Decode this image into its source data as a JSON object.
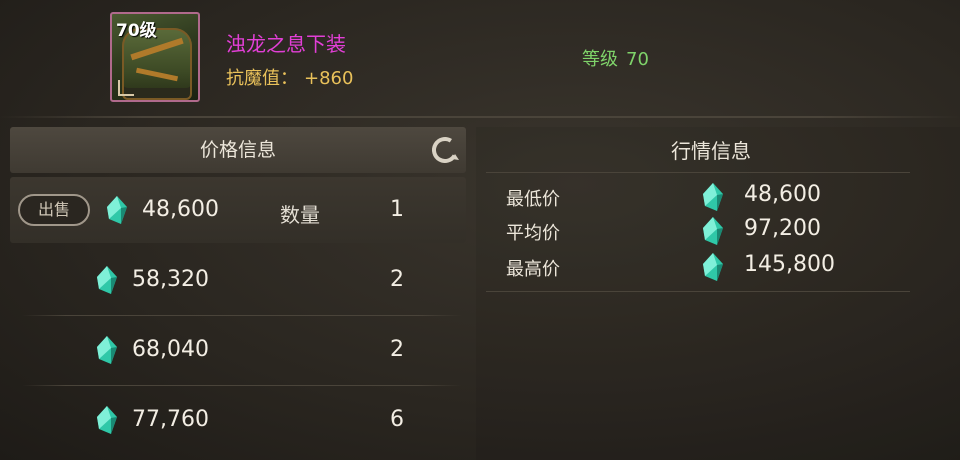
{
  "item": {
    "level_badge": "70级",
    "name": "浊龙之息下装",
    "stat_label": "抗魔值：",
    "stat_value": "+860",
    "req_level_label": "等级",
    "req_level_value": "70",
    "icon": "armor-leggings-icon",
    "name_color": "#e23fd6"
  },
  "price_panel": {
    "title": "价格信息",
    "refresh_icon": "refresh-icon",
    "sell_label": "出售",
    "qty_label": "数量",
    "rows": [
      {
        "price": "48,600",
        "qty": "1"
      },
      {
        "price": "58,320",
        "qty": "2"
      },
      {
        "price": "68,040",
        "qty": "2"
      },
      {
        "price": "77,760",
        "qty": "6"
      }
    ]
  },
  "market_panel": {
    "title": "行情信息",
    "stats": [
      {
        "label": "最低价",
        "price": "48,600"
      },
      {
        "label": "平均价",
        "price": "97,200"
      },
      {
        "label": "最高价",
        "price": "145,800"
      }
    ]
  },
  "currency_icon": "teal-gem-icon",
  "colors": {
    "accent_magenta": "#e23fd6",
    "stat_gold": "#e9c15a",
    "level_green": "#7fd36a",
    "gem_teal": "#2fc8a8"
  }
}
